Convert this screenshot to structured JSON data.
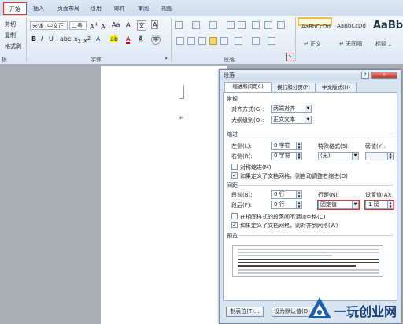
{
  "ribbon": {
    "tabs": [
      "开始",
      "插入",
      "页面布局",
      "引用",
      "邮件",
      "审阅",
      "视图"
    ],
    "clipboard": {
      "cut": "剪切",
      "copy": "复制",
      "format_painter": "格式刷",
      "label": "板"
    },
    "font": {
      "font_name": "宋体 (中文正)",
      "font_size": "二号",
      "label": "字体"
    },
    "paragraph": {
      "label": "段落"
    },
    "styles": [
      {
        "sample": "AaBbCcDd",
        "name": "↵ 正文"
      },
      {
        "sample": "AaBbCcDd",
        "name": "↵ 无间隔"
      },
      {
        "sample": "AaBb",
        "name": "标题 1"
      }
    ]
  },
  "document": {
    "paragraph_mark": "↵"
  },
  "dialog": {
    "title": "段落",
    "help": "?",
    "close": "×",
    "tabs": [
      "缩进和间距(I)",
      "换行和分页(P)",
      "中文版式(H)"
    ],
    "general": {
      "heading": "常规",
      "alignment_label": "对齐方式(G):",
      "alignment_value": "两端对齐",
      "outline_label": "大纲级别(O):",
      "outline_value": "正文文本"
    },
    "indent": {
      "heading": "缩进",
      "left_label": "左侧(L):",
      "left_value": "0 字符",
      "right_label": "右侧(R):",
      "right_value": "0 字符",
      "special_label": "特殊格式(S):",
      "special_value": "(无)",
      "by_label": "磅值(Y):",
      "mirror_indent": "对称缩进(M)",
      "auto_adjust": "如果定义了文档网格，则自动调整右缩进(D)"
    },
    "spacing": {
      "heading": "间距",
      "before_label": "段前(B):",
      "before_value": "0 行",
      "after_label": "段后(F):",
      "after_value": "0 行",
      "line_label": "行距(N):",
      "line_value": "固定值",
      "at_label": "设置值(A):",
      "at_value": "1 磅",
      "no_space_same_style": "在相同样式的段落间不添加空格(C)",
      "snap_to_grid": "如果定义了文档网格，则对齐到网格(W)"
    },
    "preview": {
      "heading": "预览"
    },
    "buttons": {
      "tabs": "制表位(T)...",
      "default": "设为默认值(D)"
    }
  },
  "watermark": {
    "text": "一玩创业网"
  },
  "colors": {
    "highlight": "#e0322a",
    "accent": "#1f5fa8"
  }
}
